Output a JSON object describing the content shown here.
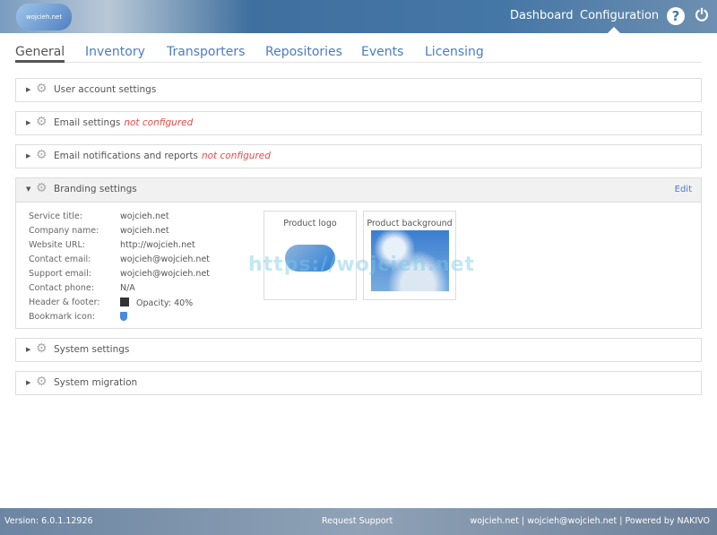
{
  "header": {
    "logo_text": "wojcieh.net",
    "nav": [
      "Dashboard",
      "Configuration"
    ],
    "active_nav": "Configuration"
  },
  "tabs": [
    "General",
    "Inventory",
    "Transporters",
    "Repositories",
    "Events",
    "Licensing"
  ],
  "active_tab": "General",
  "sections": [
    {
      "label": "User account settings",
      "status": ""
    },
    {
      "label": "Email settings",
      "status": "not configured"
    },
    {
      "label": "Email notifications and reports",
      "status": "not configured"
    },
    {
      "label": "Branding settings",
      "status": "",
      "expanded": true
    },
    {
      "label": "System settings",
      "status": ""
    },
    {
      "label": "System migration",
      "status": ""
    }
  ],
  "branding": {
    "edit_label": "Edit",
    "fields": [
      {
        "label": "Service title:",
        "value": "wojcieh.net"
      },
      {
        "label": "Company name:",
        "value": "wojcieh.net"
      },
      {
        "label": "Website URL:",
        "value": "http://wojcieh.net"
      },
      {
        "label": "Contact email:",
        "value": "wojcieh@wojcieh.net"
      },
      {
        "label": "Support email:",
        "value": "wojcieh@wojcieh.net"
      },
      {
        "label": "Contact phone:",
        "value": "N/A"
      },
      {
        "label": "Header & footer:",
        "value": "Opacity: 40%",
        "swatch": "#333333"
      },
      {
        "label": "Bookmark icon:",
        "value": ""
      }
    ],
    "product_logo_label": "Product logo",
    "product_background_label": "Product background"
  },
  "watermark": "https://wojcieh.net",
  "footer": {
    "version": "Version: 6.0.1.12926",
    "support": "Request Support",
    "right": "wojcieh.net | wojcieh@wojcieh.net | Powered by NAKIVO"
  },
  "colors": {
    "accent": "#4a7cc4",
    "warning": "#e84a4a"
  }
}
